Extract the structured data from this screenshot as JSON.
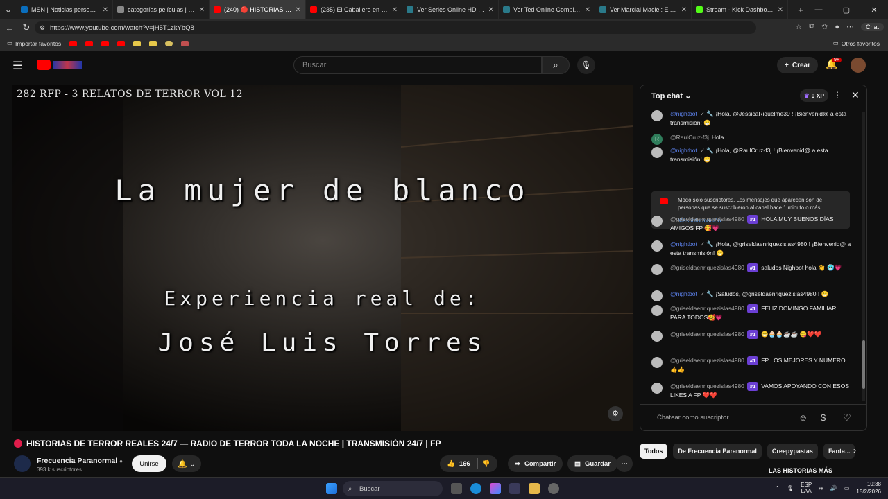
{
  "browser": {
    "tabs": [
      {
        "title": "MSN | Noticias personaliza...",
        "color": "#0a6ebd"
      },
      {
        "title": "categorías películas | el refu...",
        "color": "#888888"
      },
      {
        "title": "(240) 🔴 HISTORIAS DE...",
        "color": "#ff0000",
        "active": true
      },
      {
        "title": "(235) El Caballero en una...",
        "color": "#ff0000"
      },
      {
        "title": "Ver Series Online HD Gratis ...",
        "color": "#2a7a8a"
      },
      {
        "title": "Ver Ted Online Completa Gr...",
        "color": "#2a7a8a"
      },
      {
        "title": "Ver Marcial Maciel: El Lobo ...",
        "color": "#2a7a8a"
      },
      {
        "title": "Stream - Kick Dashboard",
        "color": "#53fc18"
      }
    ],
    "url": "https://www.youtube.com/watch?v=jH5T1zkYbQ8",
    "chat_label": "Chat",
    "bookmarks": {
      "import_label": "Importar favoritos",
      "others_label": "Otros favoritos"
    }
  },
  "header": {
    "search_placeholder": "Buscar",
    "create_label": "Crear",
    "notif_count": "9+"
  },
  "video": {
    "overlay_title": "282 RFP - 3 RELATOS DE TERROR VOL 12",
    "line1": "La mujer de blanco",
    "line2": "Experiencia real de:",
    "line3": "José Luis Torres",
    "stream_title": "HISTORIAS DE TERROR REALES 24/7 — RADIO DE TERROR TODA LA NOCHE | TRANSMISIÓN 24/7 | FP"
  },
  "channel": {
    "name": "Frecuencia Paranormal",
    "subs": "393 k suscriptores",
    "join_label": "Unirse",
    "likes": "166",
    "share_label": "Compartir",
    "save_label": "Guardar"
  },
  "chat": {
    "header": "Top chat",
    "xp": "0 XP",
    "input_placeholder": "Chatear como suscriptor...",
    "system_notice": "Modo solo suscriptores. Los mensajes que aparecen son de personas que se suscribieron al canal hace 1 minuto o más.",
    "system_more": "Más información",
    "messages": [
      {
        "author": "@nightbot",
        "bot": true,
        "text": "¡Hola, @JessicaRiquelme39 ! ¡Bienvenid@ a esta transmisión! 😁"
      },
      {
        "author": "@RaulCruz-f3j",
        "bot": false,
        "avatar": "R",
        "text": "Hola"
      },
      {
        "author": "@nightbot",
        "bot": true,
        "text": "¡Hola, @RaulCruz-f3j ! ¡Bienvenid@ a esta transmisión! 😁"
      },
      {
        "author": "@griseldaenriquezislas4980",
        "badge": "#1",
        "text": "HOLA MUY BUENOS DÍAS AMIGOS FP 🥰💗"
      },
      {
        "author": "@nightbot",
        "bot": true,
        "text": "¡Hola, @griseldaenriquezislas4980 ! ¡Bienvenid@ a esta transmisión! 😁"
      },
      {
        "author": "@griseldaenriquezislas4980",
        "badge": "#1",
        "text": "saludos Nighbot hola 👋 🥶💗"
      },
      {
        "author": "@nightbot",
        "bot": true,
        "text": "¡Saludos, @griseldaenriquezislas4980 ! 😁"
      },
      {
        "author": "@griseldaenriquezislas4980",
        "badge": "#1",
        "text": "FELIZ DOMINGO FAMILIAR PARA TODOS🥰💗"
      },
      {
        "author": "@griseldaenriquezislas4980",
        "badge": "#1",
        "text": "😁🧁🧁☕☕ 😋❤️❤️"
      },
      {
        "author": "@griseldaenriquezislas4980",
        "badge": "#1",
        "text": "FP LOS MEJORES Y NÚMERO 👍👍"
      },
      {
        "author": "@griseldaenriquezislas4980",
        "badge": "#1",
        "text": "VAMOS APOYANDO CON ESOS LIKES A FP ❤️❤️"
      }
    ]
  },
  "chips": [
    "Todos",
    "De Frecuencia Paranormal",
    "Creepypastas",
    "Fanta..."
  ],
  "related_title": "LAS HISTORIAS MÁS",
  "taskbar": {
    "search_label": "Buscar",
    "lang1": "ESP",
    "lang2": "LAA",
    "time": "10:38",
    "date": "15/2/2026"
  },
  "colors": {
    "brand_red": "#ff0000",
    "member_purple": "#6b3fd4",
    "bot_blue": "#5e84f1"
  }
}
